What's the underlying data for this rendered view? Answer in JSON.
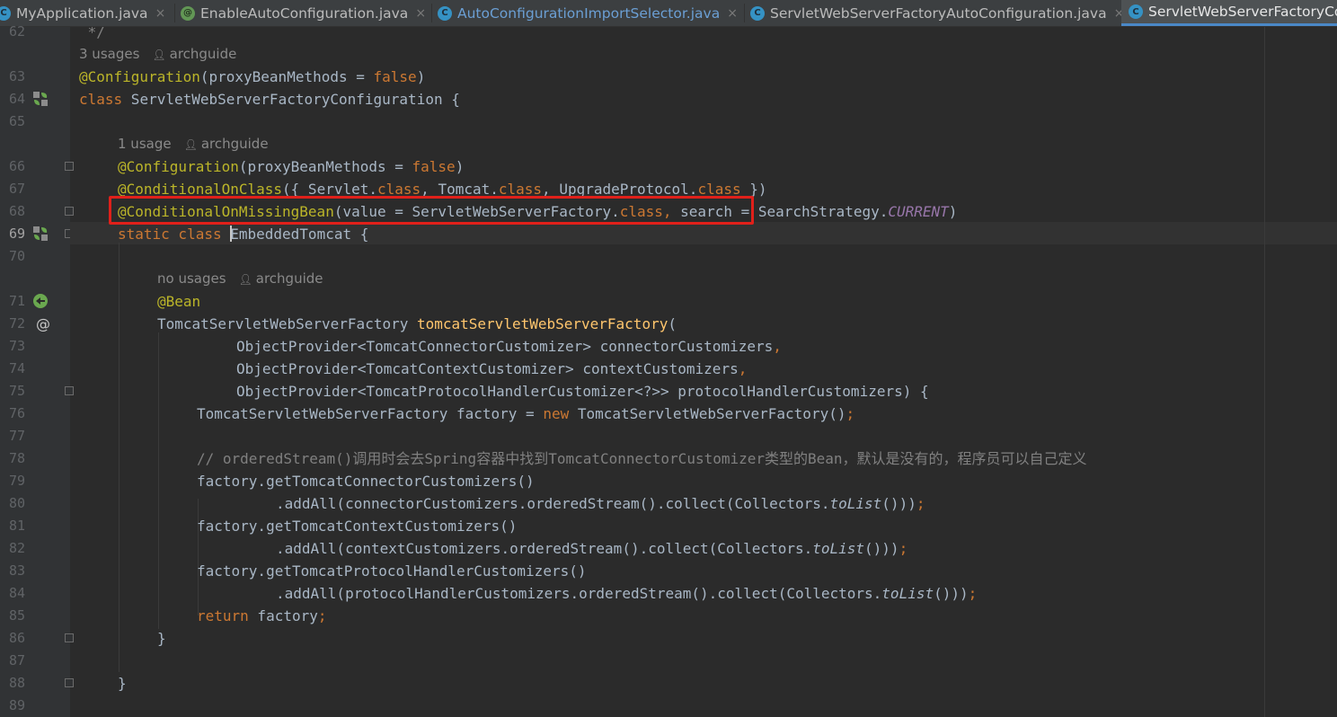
{
  "tabs": [
    {
      "label": "MyApplication.java",
      "icon": "class-icon",
      "state": "normal"
    },
    {
      "label": "EnableAutoConfiguration.java",
      "icon": "annotation-icon",
      "state": "normal"
    },
    {
      "label": "AutoConfigurationImportSelector.java",
      "icon": "class-icon",
      "state": "modified"
    },
    {
      "label": "ServletWebServerFactoryAutoConfiguration.java",
      "icon": "class-icon",
      "state": "normal"
    },
    {
      "label": "ServletWebServerFactoryConfiguration.java",
      "icon": "class-icon",
      "state": "active"
    }
  ],
  "tab_close_glyph": "×",
  "gutter": {
    "line_numbers": [
      "62",
      "",
      "63",
      "64",
      "65",
      "",
      "66",
      "67",
      "68",
      "69",
      "70",
      "",
      "71",
      "72",
      "73",
      "74",
      "75",
      "76",
      "77",
      "78",
      "79",
      "80",
      "81",
      "82",
      "83",
      "84",
      "85",
      "86",
      "87",
      "88",
      "89"
    ],
    "current_line": "69"
  },
  "hints": {
    "h1": {
      "usages": "3 usages",
      "author": "archguide"
    },
    "h2": {
      "usages": "1 usage",
      "author": "archguide"
    },
    "h3": {
      "usages": "no usages",
      "author": "archguide"
    }
  },
  "code": {
    "l62": " */",
    "l63_ann": "@Configuration",
    "l63_rest": "(proxyBeanMethods = ",
    "l63_false": "false",
    "l63_end": ")",
    "l64_kw": "class",
    "l64_rest": " ServletWebServerFactoryConfiguration {",
    "l66_ann": "@Configuration",
    "l66_rest": "(proxyBeanMethods = ",
    "l66_false": "false",
    "l66_end": ")",
    "l67_ann": "@ConditionalOnClass",
    "l67_a": "({ Servlet.",
    "l67_k1": "class",
    "l67_b": ", Tomcat.",
    "l67_k2": "class",
    "l67_c": ", UpgradeProtocol.",
    "l67_k3": "class",
    "l67_d": " })",
    "l68_ann": "@ConditionalOnMissingBean",
    "l68_a": "(value = ServletWebServerFactory.",
    "l68_k1": "class",
    "l68_comma": ",",
    "l68_b": " search = SearchStrategy.",
    "l68_const": "CURRENT",
    "l68_end": ")",
    "l69_kw": "static class ",
    "l69_name": "EmbeddedTomcat",
    "l69_rest": " {",
    "l71_ann": "@Bean",
    "l72_type": "TomcatServletWebServerFactory ",
    "l72_fn": "tomcatServletWebServerFactory",
    "l72_end": "(",
    "l73": "ObjectProvider<TomcatConnectorCustomizer> connectorCustomizers",
    "l74": "ObjectProvider<TomcatContextCustomizer> contextCustomizers",
    "l75": "ObjectProvider<TomcatProtocolHandlerCustomizer<?>> protocolHandlerCustomizers) {",
    "comma": ",",
    "l76_a": "TomcatServletWebServerFactory factory = ",
    "l76_kw": "new",
    "l76_b": " TomcatServletWebServerFactory()",
    "semi": ";",
    "l78": "// orderedStream()调用时会去Spring容器中找到TomcatConnectorCustomizer类型的Bean，默认是没有的，程序员可以自己定义",
    "l79": "factory.getTomcatConnectorCustomizers()",
    "l80_a": ".addAll(connectorCustomizers.orderedStream().collect(Collectors.",
    "toList": "toList",
    "close3": "()))",
    "l81": "factory.getTomcatContextCustomizers()",
    "l82_a": ".addAll(contextCustomizers.orderedStream().collect(Collectors.",
    "l83": "factory.getTomcatProtocolHandlerCustomizers()",
    "l84_a": ".addAll(protocolHandlerCustomizers.orderedStream().collect(Collectors.",
    "l85_kw": "return",
    "l85_rest": " factory",
    "brace": "}"
  },
  "colors": {
    "background": "#2b2b2b",
    "keyword": "#cc7832",
    "annotation": "#bbb529",
    "method": "#ffc66d",
    "comment": "#808080",
    "constant": "#9876aa",
    "highlight_box": "#e0201a"
  }
}
